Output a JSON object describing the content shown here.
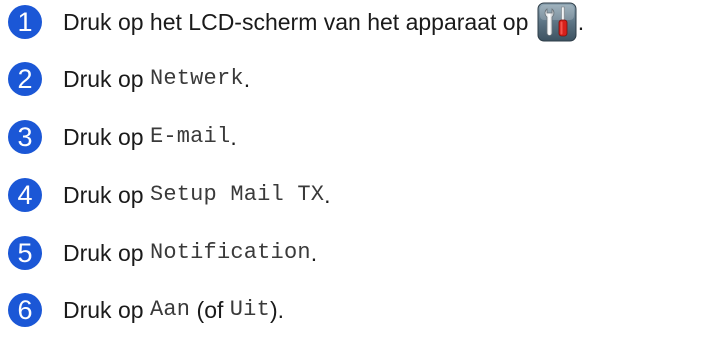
{
  "steps": [
    {
      "number": "1",
      "parts": [
        {
          "type": "text",
          "text": "Druk op het LCD-scherm van het apparaat op "
        },
        {
          "type": "icon",
          "icon": "tools-settings-icon"
        },
        {
          "type": "text",
          "text": "."
        }
      ]
    },
    {
      "number": "2",
      "parts": [
        {
          "type": "text",
          "text": "Druk op "
        },
        {
          "type": "mono",
          "text": "Netwerk"
        },
        {
          "type": "text",
          "text": "."
        }
      ]
    },
    {
      "number": "3",
      "parts": [
        {
          "type": "text",
          "text": "Druk op "
        },
        {
          "type": "mono",
          "text": "E-mail"
        },
        {
          "type": "text",
          "text": "."
        }
      ]
    },
    {
      "number": "4",
      "parts": [
        {
          "type": "text",
          "text": "Druk op "
        },
        {
          "type": "mono",
          "text": "Setup Mail TX"
        },
        {
          "type": "text",
          "text": "."
        }
      ]
    },
    {
      "number": "5",
      "parts": [
        {
          "type": "text",
          "text": "Druk op "
        },
        {
          "type": "mono",
          "text": "Notification"
        },
        {
          "type": "text",
          "text": "."
        }
      ]
    },
    {
      "number": "6",
      "parts": [
        {
          "type": "text",
          "text": "Druk op "
        },
        {
          "type": "mono",
          "text": "Aan"
        },
        {
          "type": "text",
          "text": " (of "
        },
        {
          "type": "mono",
          "text": "Uit"
        },
        {
          "type": "text",
          "text": ")."
        }
      ]
    }
  ],
  "colors": {
    "step_circle": "#1b57d6",
    "text": "#1a1a1a",
    "mono_text": "#3a3a3a"
  }
}
